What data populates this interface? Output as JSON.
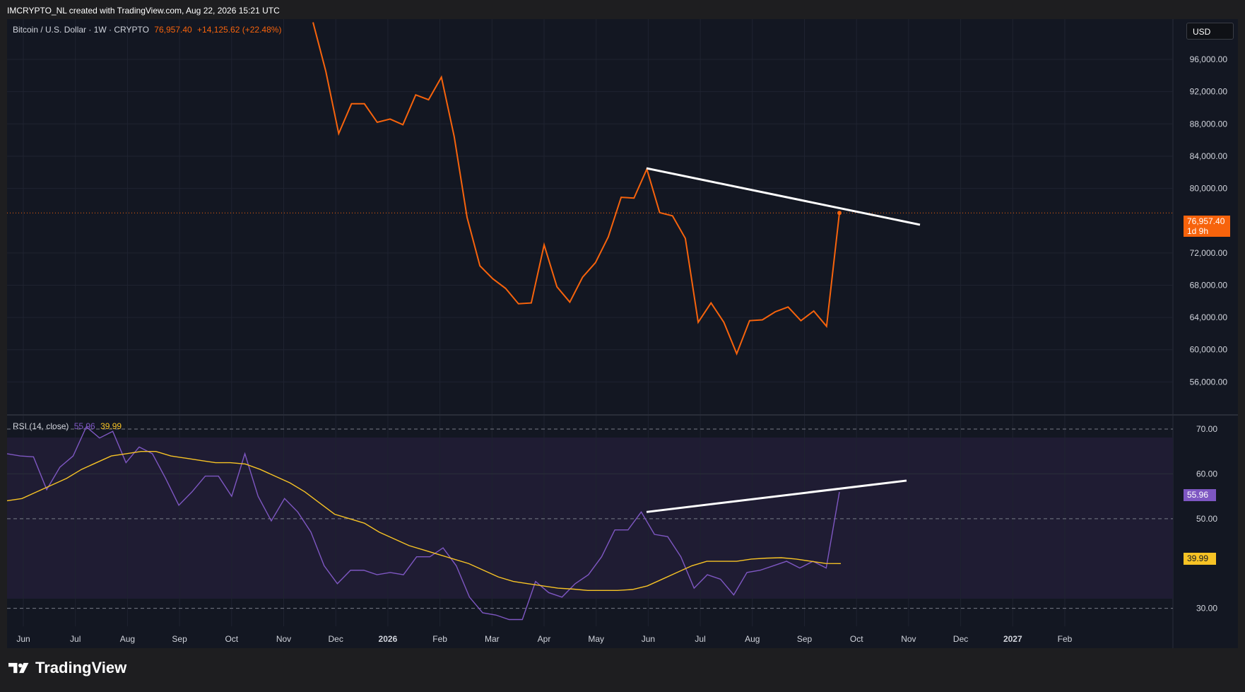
{
  "header": {
    "attribution": "IMCRYPTO_NL created with TradingView.com, Aug 22, 2026 15:21 UTC"
  },
  "main_legend": {
    "symbol": "Bitcoin / U.S. Dollar · 1W · CRYPTO",
    "last": "76,957.40",
    "change": "+14,125.62 (+22.48%)"
  },
  "rsi_legend": {
    "label": "RSI (14, close)",
    "rsi_value": "55.96",
    "ma_value": "39.99"
  },
  "currency_button": "USD",
  "price_tag": {
    "value": "76,957.40",
    "countdown": "1d 9h"
  },
  "rsi_tag": "55.96",
  "rsi_ma_tag": "39.99",
  "brand": "TradingView",
  "colors": {
    "price_line": "#f7630c",
    "rsi_line": "#7e57c2",
    "rsi_ma": "#f7c325",
    "trendline": "#ffffff",
    "background": "#131722",
    "rsi_band": "#1f1c33"
  },
  "chart_data": [
    {
      "type": "line",
      "symbol": "Bitcoin / U.S. Dollar",
      "interval": "1W",
      "y_ticks": [
        "56,000.00",
        "60,000.00",
        "64,000.00",
        "68,000.00",
        "72,000.00",
        "80,000.00",
        "84,000.00",
        "88,000.00",
        "92,000.00",
        "96,000.00"
      ],
      "x_ticks": [
        "Jun",
        "Jul",
        "Aug",
        "Sep",
        "Oct",
        "Nov",
        "Dec",
        "2026",
        "Feb",
        "Mar",
        "Apr",
        "May",
        "Jun",
        "Jul",
        "Aug",
        "Sep",
        "Oct",
        "Nov",
        "Dec",
        "2027",
        "Feb"
      ],
      "ylim": [
        52000,
        101000
      ],
      "series": [
        {
          "values": [
            100600,
            94500,
            86800,
            90500,
            90500,
            88200,
            88600,
            87900,
            91600,
            91000,
            93800,
            86400,
            76400,
            70400,
            68800,
            67600,
            65700,
            65800,
            73000,
            67800,
            65900,
            69000,
            70800,
            74000,
            78900,
            78800,
            82400,
            77000,
            76600,
            73800,
            63400,
            65800,
            63400,
            59500,
            63600,
            63700,
            64700,
            65300,
            63600,
            64800,
            62900,
            76957.4
          ]
        }
      ],
      "trendline": {
        "from": [
          "May 2026",
          82500
        ],
        "to": [
          "Sep 2026",
          75500
        ]
      }
    },
    {
      "type": "line",
      "title": "RSI (14, close)",
      "y_ticks": [
        "30.00",
        "50.00",
        "60.00",
        "70.00"
      ],
      "ylim": [
        26,
        73
      ],
      "bands": [
        30,
        50,
        70
      ],
      "series": [
        {
          "name": "RSI",
          "values": [
            64.5,
            64,
            63.8,
            56.5,
            61.5,
            64,
            70.5,
            68,
            69.5,
            62.5,
            66,
            64.5,
            59,
            53,
            56,
            59.5,
            59.5,
            55,
            64.5,
            55,
            49.5,
            54.5,
            51.5,
            47,
            39.5,
            35.5,
            38.5,
            38.5,
            37.5,
            38,
            37.5,
            41.5,
            41.5,
            43.5,
            39.5,
            32.5,
            29,
            28.5,
            27.5,
            27.5,
            36,
            33.5,
            32.5,
            35.5,
            37.5,
            41.5,
            47.5,
            47.5,
            51.5,
            46.5,
            46,
            41.5,
            34.5,
            37.5,
            36.5,
            33,
            38,
            38.5,
            39.5,
            40.5,
            39,
            40.5,
            39,
            55.96
          ]
        },
        {
          "name": "RSI-based MA",
          "values": [
            54,
            54.5,
            56,
            57.5,
            59,
            61,
            62.5,
            64,
            64.5,
            65,
            65,
            64,
            63.5,
            63,
            62.5,
            62.5,
            62.2,
            61,
            59.5,
            58,
            56,
            53.5,
            51,
            50,
            49,
            47,
            45.5,
            44,
            43,
            42,
            41,
            40,
            38.5,
            37,
            36,
            35.5,
            35,
            34.5,
            34.3,
            34,
            34,
            34,
            34.2,
            35,
            36.5,
            38,
            39.5,
            40.5,
            40.5,
            40.5,
            41,
            41.2,
            41.3,
            41,
            40.5,
            40,
            39.99
          ]
        }
      ],
      "trendline": {
        "from": [
          "May 2026",
          51.5
        ],
        "to": [
          "Sep 2026",
          58.5
        ]
      }
    }
  ]
}
